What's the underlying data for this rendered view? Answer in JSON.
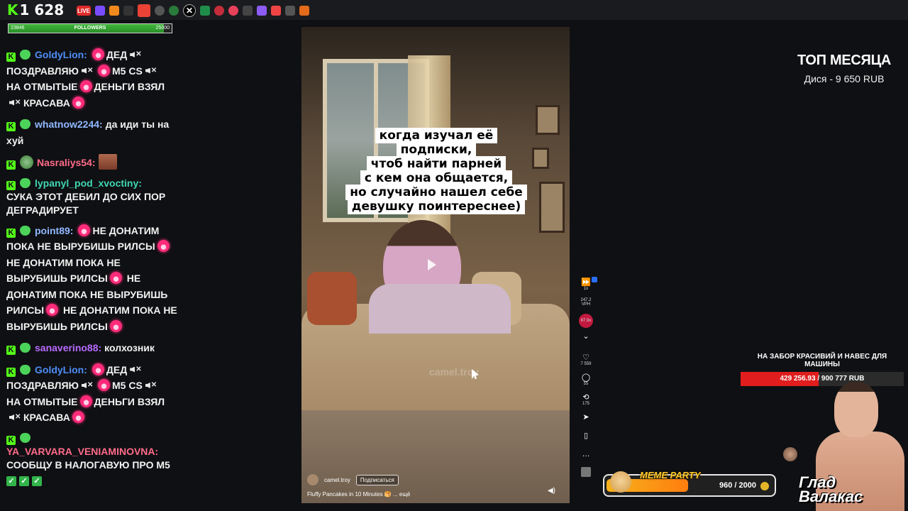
{
  "topbar": {
    "score": "1 628",
    "live_label": "LIVE"
  },
  "followers": {
    "label": "FOLLOWERS",
    "current": "23846",
    "goal": "25000",
    "progress": 0.954
  },
  "chat": [
    {
      "user": "GoldyLion:",
      "color": "#4e8ef7",
      "text": [
        "ДЕД",
        "ПОЗДРАВЛЯЮ",
        "M5 CS",
        "НА ОТМЫТЫЕ",
        "ДЕНЬГИ ВЗЯЛ",
        "КРАСАВА"
      ]
    },
    {
      "user": "whatnow2244:",
      "color": "#8fb8ff",
      "text": [
        "да иди ты на хуй"
      ]
    },
    {
      "user": "Nasraliys54:",
      "color": "#ff6b8a",
      "text": []
    },
    {
      "user": "lypanyl_pod_xvoctiny:",
      "color": "#40d6b3",
      "text": [
        "СУКА ЭТОТ ДЕБИЛ ДО СИХ ПОР ДЕГРАДИРУЕТ"
      ]
    },
    {
      "user": "point89:",
      "color": "#8fb8ff",
      "text": [
        "НЕ ДОНАТИМ ПОКА НЕ ВЫРУБИШЬ РИЛСЫ",
        "НЕ ДОНАТИМ ПОКА НЕ ВЫРУБИШЬ РИЛСЫ",
        "НЕ ДОНАТИМ ПОКА НЕ ВЫРУБИШЬ РИЛСЫ",
        "НЕ ДОНАТИМ ПОКА НЕ ВЫРУБИШЬ РИЛСЫ"
      ]
    },
    {
      "user": "sanaverino88:",
      "color": "#b86bff",
      "text": [
        "колхозник"
      ]
    },
    {
      "user": "GoldyLion:",
      "color": "#4e8ef7",
      "text": [
        "ДЕД",
        "ПОЗДРАВЛЯЮ",
        "M5 CS",
        "НА ОТМЫТЫЕ",
        "ДЕНЬГИ ВЗЯЛ",
        "КРАСАВА"
      ]
    },
    {
      "user": "YA_VARVARA_VENIAMINOVNA:",
      "color": "#ff6b8a",
      "text": [
        "СООБЩУ В НАЛОГАВУЮ ПРО M5"
      ]
    }
  ],
  "video": {
    "caption_lines": [
      "когда изучал её подписки,",
      "чтоб найти парней",
      "с кем она общается,",
      "но случайно нашел себе",
      "девушку поинтереснее)"
    ],
    "author": "camel.troy",
    "subscribe_label": "Подписаться",
    "description": "Fluffy Pancakes in 10 Minutes 🥞 ... ещё",
    "watermark": "camel.troy"
  },
  "side_controls": {
    "speed": "1x",
    "views": "247.2",
    "views_unit": "VPH",
    "velocity": "87.9x",
    "likes": "7 559",
    "comments": "55",
    "reposts": "175"
  },
  "top_month": {
    "title": "ТОП МЕСЯЦА",
    "entry": "Дися - 9 650 RUB"
  },
  "goal": {
    "title": "НА ЗАБОР КРАСИВИЙ И НАВЕС ДЛЯ МАШИНЫ",
    "value": "429 256.93 / 900 777 RUB",
    "progress": 0.4765
  },
  "meme_party": {
    "title": "MEME PARTY",
    "value": "960 / 2000",
    "progress": 0.48
  },
  "streamer_name": "Глад\nВалакас"
}
